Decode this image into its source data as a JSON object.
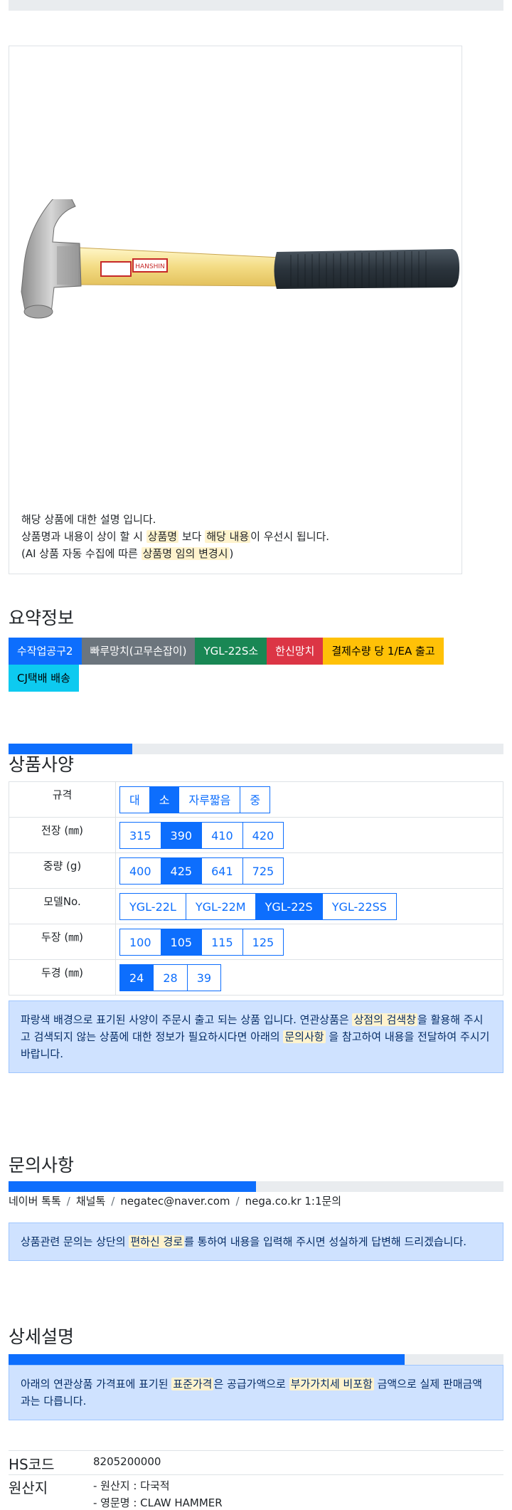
{
  "product_image": {
    "alt": "claw hammer",
    "handle_label": "HANSHIN"
  },
  "description": {
    "line1": "해당 상품에 대한 설명 입니다.",
    "line2_pre": "상품명과 내용이 상이 할 시 ",
    "line2_hl1": "상품명",
    "line2_mid": " 보다 ",
    "line2_hl2": "해당 내용",
    "line2_post": "이 우선시 됩니다.",
    "line3_pre": "(AI 상품 자동 수집에 따른 ",
    "line3_hl": "상품명 임의 변경시",
    "line3_post": ")"
  },
  "summary": {
    "title": "요약정보",
    "badges": [
      {
        "label": "수작업공구2",
        "style": "primary"
      },
      {
        "label": "빠루망치(고무손잡이)",
        "style": "secondary"
      },
      {
        "label": "YGL-22S소",
        "style": "success"
      },
      {
        "label": "한신망치",
        "style": "danger"
      },
      {
        "label": "결제수량 당 1/EA 출고",
        "style": "warning"
      },
      {
        "label": "CJ택배 배송",
        "style": "info"
      }
    ]
  },
  "spec": {
    "title": "상품사양",
    "progress": 0.25,
    "rows": [
      {
        "label": "규격",
        "options": [
          "대",
          "소",
          "자루짧음",
          "중"
        ],
        "active": 1
      },
      {
        "label": "전장 (㎜)",
        "options": [
          "315",
          "390",
          "410",
          "420"
        ],
        "active": 1
      },
      {
        "label": "중량 (g)",
        "options": [
          "400",
          "425",
          "641",
          "725"
        ],
        "active": 1
      },
      {
        "label": "모델No.",
        "options": [
          "YGL-22L",
          "YGL-22M",
          "YGL-22S",
          "YGL-22SS"
        ],
        "active": 2
      },
      {
        "label": "두장 (㎜)",
        "options": [
          "100",
          "105",
          "115",
          "125"
        ],
        "active": 1
      },
      {
        "label": "두경 (㎜)",
        "options": [
          "24",
          "28",
          "39"
        ],
        "active": 0
      }
    ],
    "notice_pre": "파랑색 배경으로 표기된 사양이 주문시 출고 되는 상품 입니다. 연관상품은 ",
    "notice_hl1": "상점의 검색창",
    "notice_mid": "을 활용해 주시고 검색되지 않는 상품에 대한 정보가 필요하시다면 아래의 ",
    "notice_hl2": "문의사항",
    "notice_post": " 을 참고하여 내용을 전달하여 주시기 바랍니다."
  },
  "inquiry": {
    "title": "문의사항",
    "progress": 0.5,
    "contacts": [
      "네이버 톡톡",
      "채널톡",
      "negatec@naver.com",
      "nega.co.kr 1:1문의"
    ],
    "separator": "/",
    "notice_pre": "상품관련 문의는 상단의 ",
    "notice_hl": "편하신 경로",
    "notice_post": "를 통하여 내용을 입력해 주시면 성실하게 답변해 드리겠습니다."
  },
  "detail": {
    "title": "상세설명",
    "progress": 0.8,
    "notice_pre": "아래의 연관상품 가격표에 표기된 ",
    "notice_hl1": "표준가격",
    "notice_mid": "은 공급가액으로 ",
    "notice_hl2": "부가가치세 비포함",
    "notice_post": " 금액으로 실제 판매금액과는 다릅니다."
  },
  "info_rows": {
    "hs_label": "HS코드",
    "hs_value": "8205200000",
    "origin_label": "원산지",
    "origin_line1": "- 원산지 : 다국적",
    "origin_line2": "- 영문명 : CLAW HAMMER"
  },
  "colors": {
    "primary": "#0d6efd",
    "alert_bg": "#cfe2ff",
    "highlight": "#fff3cd"
  }
}
